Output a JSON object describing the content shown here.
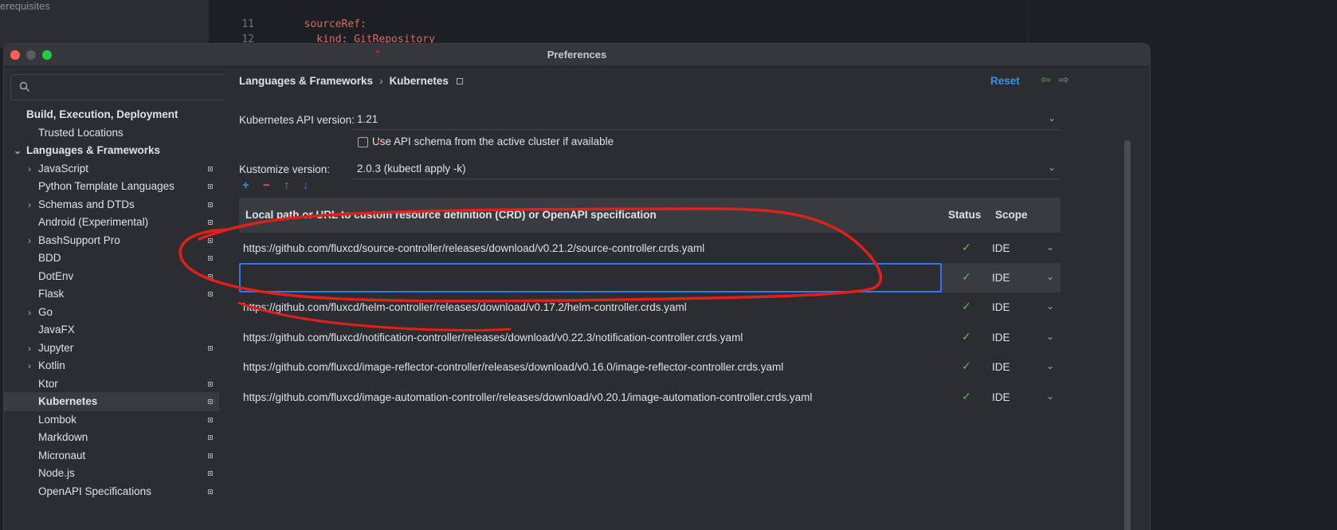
{
  "background": {
    "left_text": "erequisites",
    "lines": [
      {
        "num": "11",
        "code": "sourceRef:"
      },
      {
        "num": "12",
        "code": "  kind: GitRepository"
      }
    ]
  },
  "window": {
    "title": "Preferences"
  },
  "sidebar": {
    "search_placeholder": "",
    "items": [
      {
        "label": "Build, Execution, Deployment"
      },
      {
        "label": "Trusted Locations"
      },
      {
        "label": "Languages & Frameworks"
      },
      {
        "label": "JavaScript"
      },
      {
        "label": "Python Template Languages"
      },
      {
        "label": "Schemas and DTDs"
      },
      {
        "label": "Android (Experimental)"
      },
      {
        "label": "BashSupport Pro"
      },
      {
        "label": "BDD"
      },
      {
        "label": "DotEnv"
      },
      {
        "label": "Flask"
      },
      {
        "label": "Go"
      },
      {
        "label": "JavaFX"
      },
      {
        "label": "Jupyter"
      },
      {
        "label": "Kotlin"
      },
      {
        "label": "Ktor"
      },
      {
        "label": "Kubernetes"
      },
      {
        "label": "Lombok"
      },
      {
        "label": "Markdown"
      },
      {
        "label": "Micronaut"
      },
      {
        "label": "Node.js"
      },
      {
        "label": "OpenAPI Specifications"
      }
    ]
  },
  "content": {
    "breadcrumb": [
      "Languages & Frameworks",
      "Kubernetes"
    ],
    "breadcrumb_sep": "›",
    "reset_label": "Reset",
    "api_version_label": "Kubernetes API version:",
    "api_version_value": "1.21",
    "use_schema_label": "Use API schema from the active cluster if available",
    "kustomize_label": "Kustomize version:",
    "kustomize_value": "2.0.3 (kubectl apply -k)",
    "table": {
      "headers": {
        "path": "Local path or URL to custom resource definition (CRD) or OpenAPI specification",
        "status": "Status",
        "scope": "Scope"
      },
      "rows": [
        {
          "url": "https://github.com/fluxcd/source-controller/releases/download/v0.21.2/source-controller.crds.yaml",
          "scope": "IDE"
        },
        {
          "url": "",
          "scope": "IDE"
        },
        {
          "url": "https://github.com/fluxcd/helm-controller/releases/download/v0.17.2/helm-controller.crds.yaml",
          "scope": "IDE"
        },
        {
          "url": "https://github.com/fluxcd/notification-controller/releases/download/v0.22.3/notification-controller.crds.yaml",
          "scope": "IDE"
        },
        {
          "url": "https://github.com/fluxcd/image-reflector-controller/releases/download/v0.16.0/image-reflector-controller.crds.yaml",
          "scope": "IDE"
        },
        {
          "url": "https://github.com/fluxcd/image-automation-controller/releases/download/v0.20.1/image-automation-controller.crds.yaml",
          "scope": "IDE"
        }
      ]
    }
  },
  "colors": {
    "accent": "#3574f0",
    "annotation": "#e0201b",
    "status_ok": "#5fb85f"
  }
}
